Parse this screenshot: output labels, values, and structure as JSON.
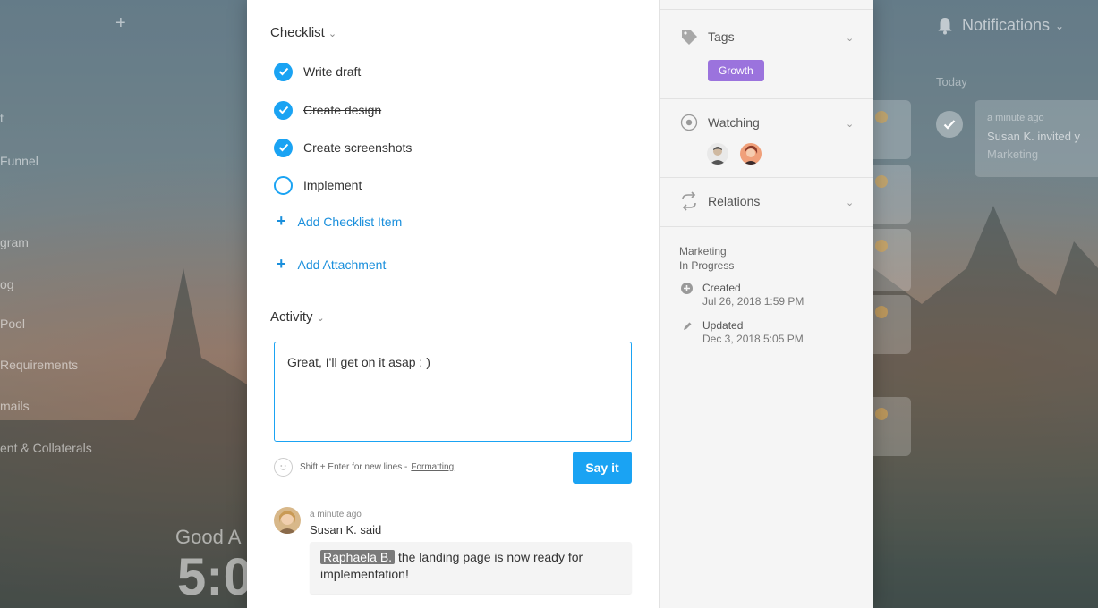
{
  "leftnav": {
    "plus": "+",
    "items": [
      "t",
      "Funnel",
      "gram",
      "og",
      "Pool",
      "Requirements",
      "mails",
      "ent & Collaterals"
    ],
    "greeting": "Good A",
    "clock": "5:0"
  },
  "checklist": {
    "title": "Checklist",
    "chevron": "⌄",
    "items": [
      {
        "label": "Write draft",
        "done": true
      },
      {
        "label": "Create design",
        "done": true
      },
      {
        "label": "Create screenshots",
        "done": true
      },
      {
        "label": "Implement",
        "done": false
      }
    ],
    "add_item": "Add Checklist Item",
    "add_attachment": "Add Attachment"
  },
  "activity": {
    "title": "Activity",
    "input_value": "Great, I'll get on it asap : )",
    "hint": "Shift + Enter for new lines  -",
    "formatting": "Formatting",
    "submit": "Say it",
    "comment": {
      "time": "a minute ago",
      "author": "Susan K. said",
      "mention": "Raphaela B.",
      "text": " the landing page is now ready for implementation!"
    }
  },
  "side": {
    "tags_label": "Tags",
    "tag": "Growth",
    "watching_label": "Watching",
    "relations_label": "Relations",
    "project": "Marketing",
    "status": "In Progress",
    "created_label": "Created",
    "created_date": "Jul 26, 2018 1:59 PM",
    "updated_label": "Updated",
    "updated_date": "Dec 3, 2018 5:05 PM"
  },
  "notifications": {
    "title": "Notifications",
    "today": "Today",
    "time": "a minute ago",
    "text": "Susan K. invited y",
    "sub": "Marketing"
  },
  "colors": {
    "accent": "#1aa3f3",
    "tag": "#9b73dd"
  }
}
